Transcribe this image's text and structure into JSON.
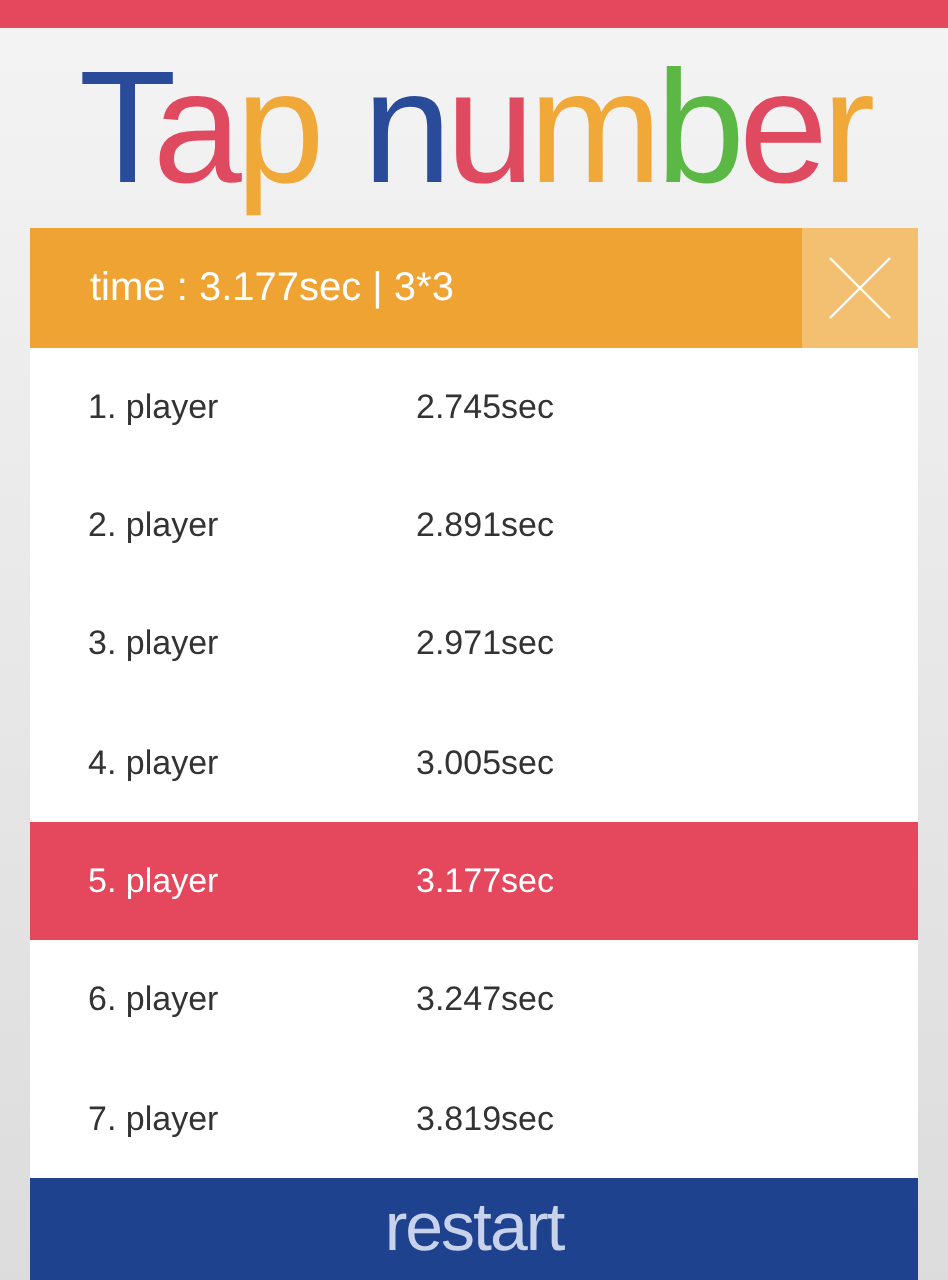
{
  "title": {
    "words": [
      {
        "letters": [
          {
            "char": "T",
            "color": "#2a4a9a"
          },
          {
            "char": "a",
            "color": "#e04a60"
          },
          {
            "char": "p",
            "color": "#f0a838"
          }
        ]
      },
      {
        "letters": [
          {
            "char": "n",
            "color": "#2a4a9a"
          },
          {
            "char": "u",
            "color": "#e04a60"
          },
          {
            "char": "m",
            "color": "#f0a838"
          },
          {
            "char": "b",
            "color": "#5cb845"
          },
          {
            "char": "e",
            "color": "#e04a60"
          },
          {
            "char": "r",
            "color": "#f0a838"
          }
        ]
      }
    ]
  },
  "result": {
    "text": "time : 3.177sec | 3*3"
  },
  "ranking": [
    {
      "rank": "1. player",
      "time": "2.745sec",
      "selected": false
    },
    {
      "rank": "2. player",
      "time": "2.891sec",
      "selected": false
    },
    {
      "rank": "3. player",
      "time": "2.971sec",
      "selected": false
    },
    {
      "rank": "4. player",
      "time": "3.005sec",
      "selected": false
    },
    {
      "rank": "5. player",
      "time": "3.177sec",
      "selected": true
    },
    {
      "rank": "6. player",
      "time": "3.247sec",
      "selected": false
    },
    {
      "rank": "7. player",
      "time": "3.819sec",
      "selected": false
    }
  ],
  "restart_button": {
    "label": "restart"
  }
}
